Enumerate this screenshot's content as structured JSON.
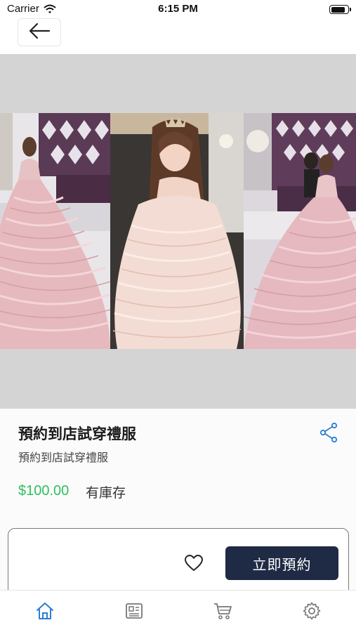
{
  "status_bar": {
    "carrier": "Carrier",
    "time": "6:15 PM",
    "battery_level": 0.9
  },
  "header": {
    "back_icon": "arrow-left-icon"
  },
  "product": {
    "title": "預約到店試穿禮服",
    "subtitle": "預約到店試穿禮服",
    "price": "$100.00",
    "stock_status": "有庫存",
    "share_icon": "share-icon"
  },
  "actions": {
    "favorite_icon": "heart-icon",
    "book_label": "立即預約"
  },
  "tabbar": {
    "items": [
      {
        "icon": "home-icon",
        "active": true
      },
      {
        "icon": "news-icon",
        "active": false
      },
      {
        "icon": "cart-icon",
        "active": false
      },
      {
        "icon": "gear-icon",
        "active": false
      }
    ]
  },
  "colors": {
    "accent": "#2a7fd4",
    "price": "#2fbf5f",
    "button": "#1f2a44",
    "gallery_bg": "#d4d4d4"
  }
}
